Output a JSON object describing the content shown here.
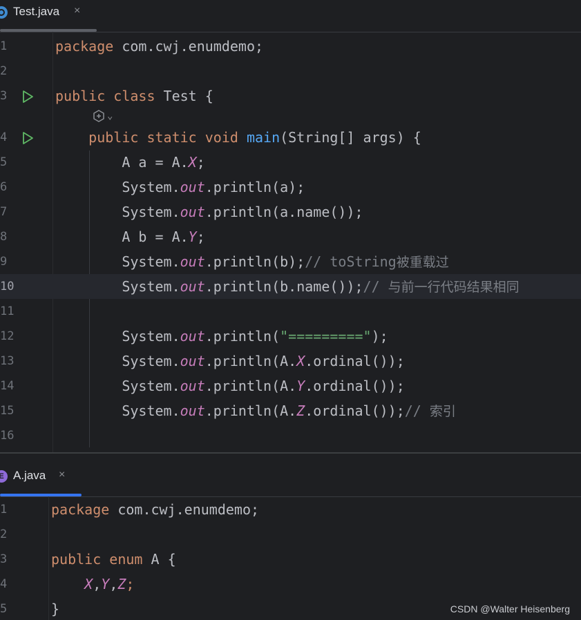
{
  "top_tab": {
    "filename": "Test.java",
    "icon": "java-class-icon",
    "close": "×"
  },
  "bottom_tab": {
    "filename": "A.java",
    "icon": "java-enum-icon",
    "icon_letter": "E",
    "close": "×"
  },
  "colors": {
    "background": "#1e1f22",
    "keyword": "#cf8e6d",
    "method": "#56a8f5",
    "static_field": "#c77dbb",
    "string": "#6aab73",
    "comment": "#7a7e85",
    "run": "#5fb865"
  },
  "test_java": {
    "lines": [
      {
        "num": "1",
        "tokens": [
          {
            "c": "kw",
            "t": "package"
          },
          {
            "c": "",
            "t": " com.cwj.enumdemo;"
          }
        ]
      },
      {
        "num": "2",
        "tokens": []
      },
      {
        "num": "3",
        "run": true,
        "tokens": [
          {
            "c": "kw",
            "t": "public class"
          },
          {
            "c": "",
            "t": " Test {"
          }
        ]
      },
      {
        "num": "4",
        "run": true,
        "tokens": [
          {
            "c": "",
            "t": "    "
          },
          {
            "c": "kw",
            "t": "public static void"
          },
          {
            "c": "",
            "t": " "
          },
          {
            "c": "fn",
            "t": "main"
          },
          {
            "c": "",
            "t": "(String[] args) {"
          }
        ]
      },
      {
        "num": "5",
        "tokens": [
          {
            "c": "",
            "t": "        A a = A."
          },
          {
            "c": "st",
            "t": "X"
          },
          {
            "c": "",
            "t": ";"
          }
        ]
      },
      {
        "num": "6",
        "tokens": [
          {
            "c": "",
            "t": "        System."
          },
          {
            "c": "st",
            "t": "out"
          },
          {
            "c": "",
            "t": ".println(a);"
          }
        ]
      },
      {
        "num": "7",
        "tokens": [
          {
            "c": "",
            "t": "        System."
          },
          {
            "c": "st",
            "t": "out"
          },
          {
            "c": "",
            "t": ".println(a.name());"
          }
        ]
      },
      {
        "num": "8",
        "tokens": [
          {
            "c": "",
            "t": "        A b = A."
          },
          {
            "c": "st",
            "t": "Y"
          },
          {
            "c": "",
            "t": ";"
          }
        ]
      },
      {
        "num": "9",
        "tokens": [
          {
            "c": "",
            "t": "        System."
          },
          {
            "c": "st",
            "t": "out"
          },
          {
            "c": "",
            "t": ".println(b);"
          },
          {
            "c": "cm",
            "t": "// toString"
          },
          {
            "c": "cm cm-cjk",
            "t": "被重载过"
          }
        ]
      },
      {
        "num": "10",
        "current": true,
        "tokens": [
          {
            "c": "",
            "t": "        System."
          },
          {
            "c": "st",
            "t": "out"
          },
          {
            "c": "",
            "t": ".println(b.name());"
          },
          {
            "c": "cm",
            "t": "// "
          },
          {
            "c": "cm cm-cjk",
            "t": "与前一行代码结果相同"
          }
        ]
      },
      {
        "num": "11",
        "tokens": []
      },
      {
        "num": "12",
        "tokens": [
          {
            "c": "",
            "t": "        System."
          },
          {
            "c": "st",
            "t": "out"
          },
          {
            "c": "",
            "t": ".println("
          },
          {
            "c": "str",
            "t": "\"=========\""
          },
          {
            "c": "",
            "t": ");"
          }
        ]
      },
      {
        "num": "13",
        "tokens": [
          {
            "c": "",
            "t": "        System."
          },
          {
            "c": "st",
            "t": "out"
          },
          {
            "c": "",
            "t": ".println(A."
          },
          {
            "c": "st",
            "t": "X"
          },
          {
            "c": "",
            "t": ".ordinal());"
          }
        ]
      },
      {
        "num": "14",
        "tokens": [
          {
            "c": "",
            "t": "        System."
          },
          {
            "c": "st",
            "t": "out"
          },
          {
            "c": "",
            "t": ".println(A."
          },
          {
            "c": "st",
            "t": "Y"
          },
          {
            "c": "",
            "t": ".ordinal());"
          }
        ]
      },
      {
        "num": "15",
        "tokens": [
          {
            "c": "",
            "t": "        System."
          },
          {
            "c": "st",
            "t": "out"
          },
          {
            "c": "",
            "t": ".println(A."
          },
          {
            "c": "st",
            "t": "Z"
          },
          {
            "c": "",
            "t": ".ordinal());"
          },
          {
            "c": "cm",
            "t": "// "
          },
          {
            "c": "cm cm-cjk",
            "t": "索引"
          }
        ]
      },
      {
        "num": "16",
        "tokens": []
      }
    ],
    "inlay_hint": {
      "icon": "ai-assist-icon",
      "chevron": "⌄"
    }
  },
  "a_java": {
    "lines": [
      {
        "num": "1",
        "tokens": [
          {
            "c": "kw",
            "t": "package"
          },
          {
            "c": "",
            "t": " com.cwj.enumdemo;"
          }
        ]
      },
      {
        "num": "2",
        "tokens": []
      },
      {
        "num": "3",
        "tokens": [
          {
            "c": "kw",
            "t": "public enum"
          },
          {
            "c": "",
            "t": " A {"
          }
        ]
      },
      {
        "num": "4",
        "tokens": [
          {
            "c": "",
            "t": "    "
          },
          {
            "c": "st",
            "t": "X"
          },
          {
            "c": "",
            "t": ","
          },
          {
            "c": "st",
            "t": "Y"
          },
          {
            "c": "",
            "t": ","
          },
          {
            "c": "st",
            "t": "Z"
          },
          {
            "c": "kw",
            "t": ";"
          }
        ]
      },
      {
        "num": "5",
        "tokens": [
          {
            "c": "",
            "t": "}"
          }
        ]
      }
    ]
  },
  "watermark": "CSDN @Walter  Heisenberg"
}
